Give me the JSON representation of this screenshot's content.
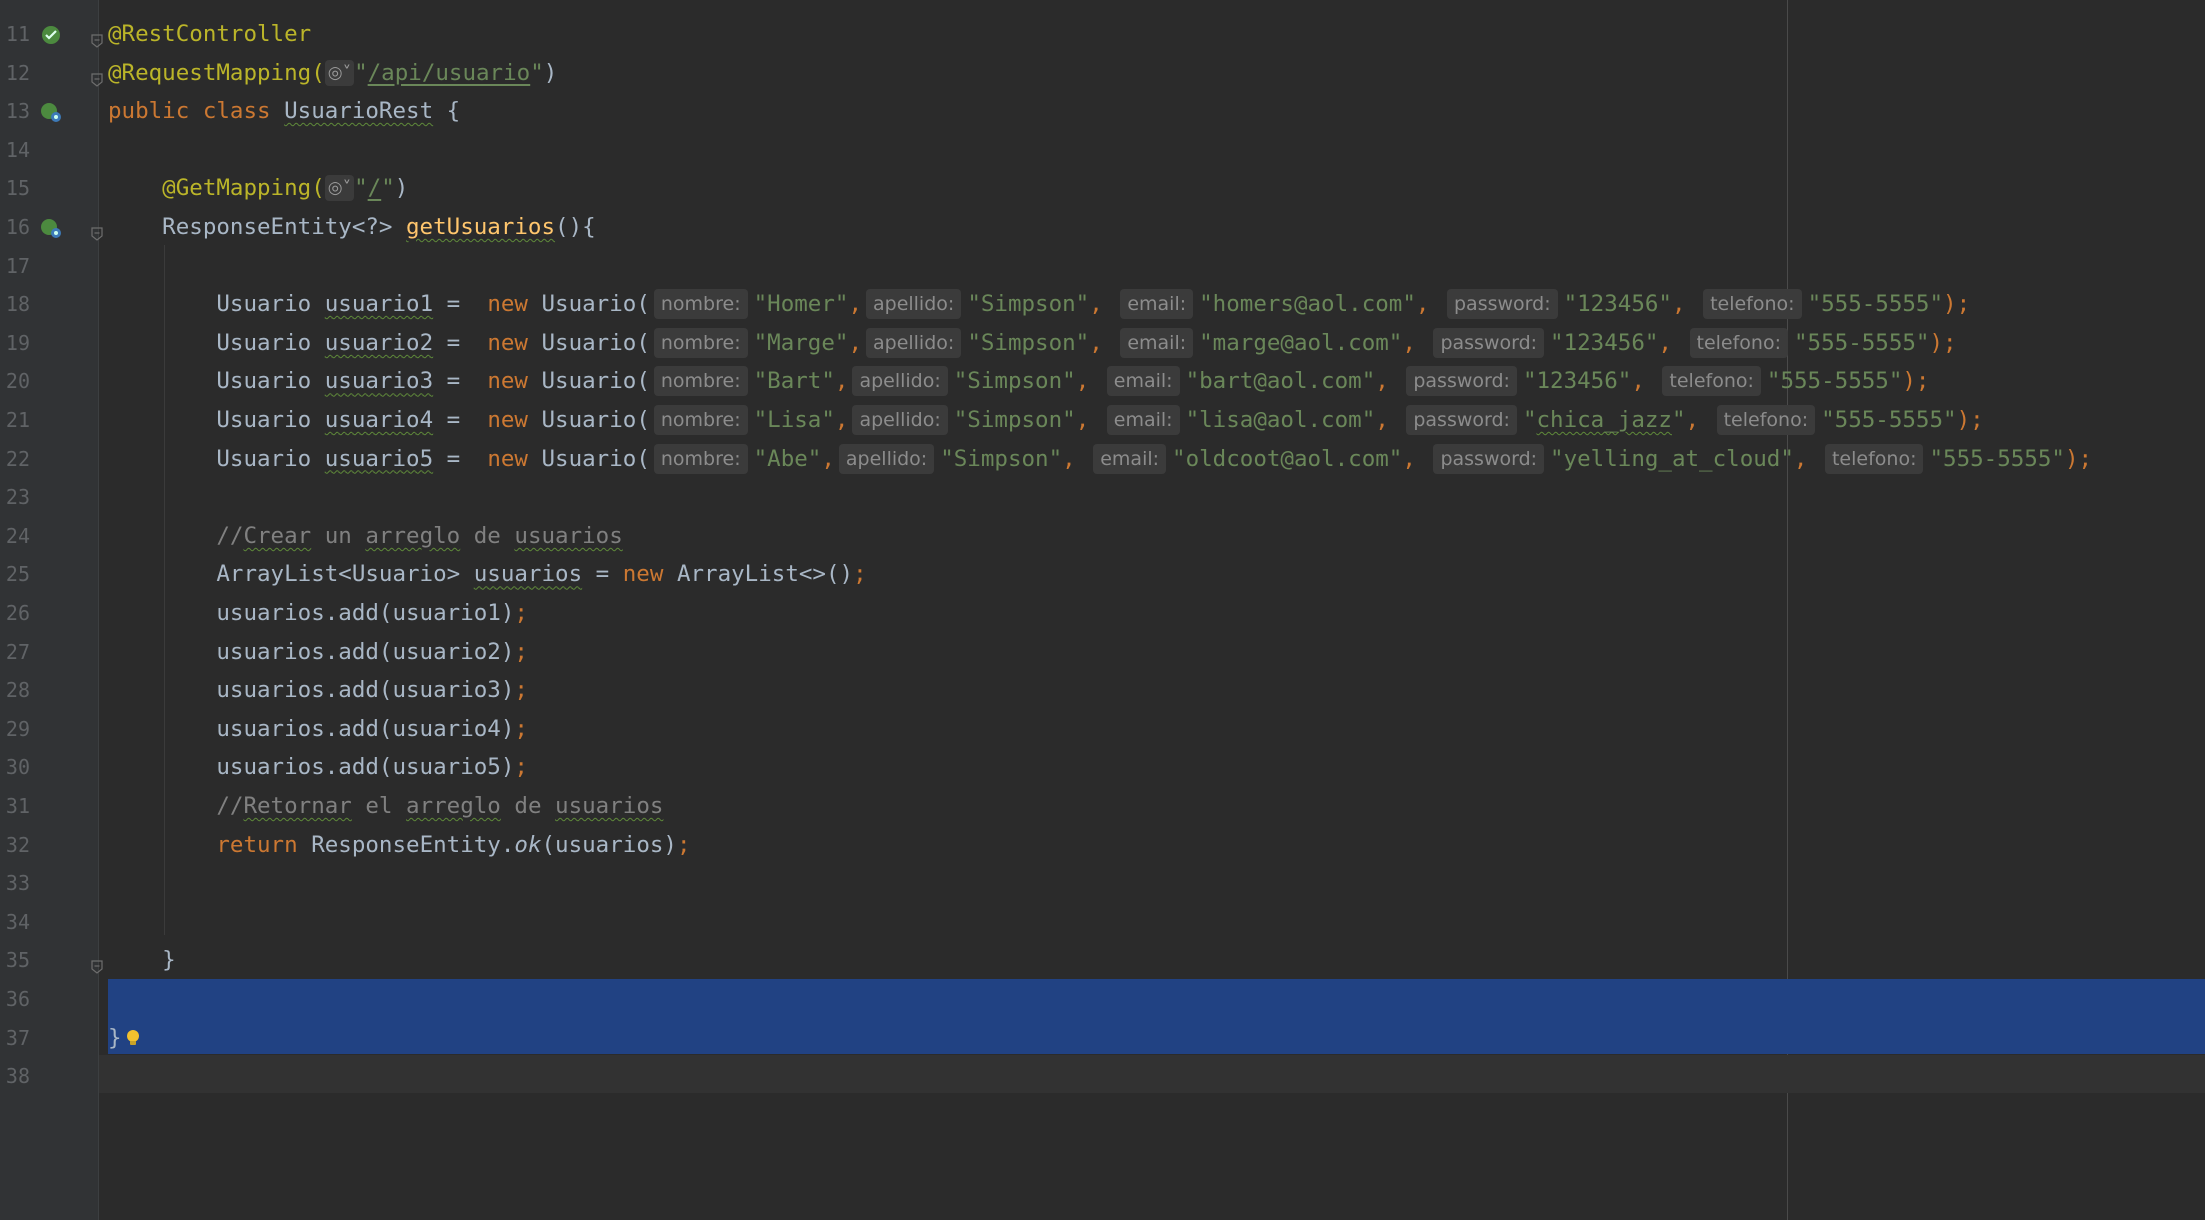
{
  "editor": {
    "language": "java",
    "first_line_number": 11,
    "lines": [
      {
        "n": "11",
        "segments": [
          {
            "t": "@RestController",
            "c": "ann"
          }
        ],
        "gutter_icon": "spring-bean-icon",
        "fold": true
      },
      {
        "n": "12",
        "segments": [
          {
            "t": "@RequestMapping(",
            "c": "ann"
          },
          {
            "t": "globe",
            "c": "globe"
          },
          {
            "t": "\"",
            "c": "str"
          },
          {
            "t": "/api/usuario",
            "c": "str link"
          },
          {
            "t": "\"",
            "c": "str"
          },
          {
            "t": ")",
            "c": ""
          }
        ],
        "fold": true
      },
      {
        "n": "13",
        "segments": [
          {
            "t": "public ",
            "c": "kw"
          },
          {
            "t": "class ",
            "c": "kw"
          },
          {
            "t": "UsuarioRest",
            "c": "typo"
          },
          {
            "t": " {",
            "c": ""
          }
        ],
        "gutter_icon": "spring-web-icon"
      },
      {
        "n": "14",
        "segments": []
      },
      {
        "n": "15",
        "segments": [
          {
            "t": "    @GetMapping(",
            "c": "ann"
          },
          {
            "t": "globe",
            "c": "globe"
          },
          {
            "t": "\"",
            "c": "str"
          },
          {
            "t": "/",
            "c": "str link"
          },
          {
            "t": "\"",
            "c": "str"
          },
          {
            "t": ")",
            "c": ""
          }
        ]
      },
      {
        "n": "16",
        "segments": [
          {
            "t": "    ResponseEntity<?> ",
            "c": ""
          },
          {
            "t": "getUsuarios",
            "c": "fn typo"
          },
          {
            "t": "(){",
            "c": ""
          }
        ],
        "gutter_icon": "spring-web-icon",
        "fold": true
      },
      {
        "n": "17",
        "segments": []
      },
      {
        "n": "18",
        "segments": [
          {
            "t": "        Usuario ",
            "c": ""
          },
          {
            "t": "usuario1",
            "c": "typo"
          },
          {
            "t": " =  ",
            "c": ""
          },
          {
            "t": "new ",
            "c": "kw"
          },
          {
            "t": "Usuario(",
            "c": ""
          },
          {
            "t": "nombre:",
            "c": "hint"
          },
          {
            "t": "\"Homer\"",
            "c": "str"
          },
          {
            "t": ",",
            "c": "kw"
          },
          {
            "t": "apellido:",
            "c": "hint"
          },
          {
            "t": "\"Simpson\"",
            "c": "str"
          },
          {
            "t": ", ",
            "c": "kw"
          },
          {
            "t": "email:",
            "c": "hint"
          },
          {
            "t": "\"homers@aol.com\"",
            "c": "str"
          },
          {
            "t": ", ",
            "c": "kw"
          },
          {
            "t": "password:",
            "c": "hint"
          },
          {
            "t": "\"123456\"",
            "c": "str"
          },
          {
            "t": ", ",
            "c": "kw"
          },
          {
            "t": "telefono:",
            "c": "hint"
          },
          {
            "t": "\"555-5555\"",
            "c": "str"
          },
          {
            "t": ");",
            "c": "kw"
          }
        ]
      },
      {
        "n": "19",
        "segments": [
          {
            "t": "        Usuario ",
            "c": ""
          },
          {
            "t": "usuario2",
            "c": "typo"
          },
          {
            "t": " =  ",
            "c": ""
          },
          {
            "t": "new ",
            "c": "kw"
          },
          {
            "t": "Usuario(",
            "c": ""
          },
          {
            "t": "nombre:",
            "c": "hint"
          },
          {
            "t": "\"Marge\"",
            "c": "str"
          },
          {
            "t": ",",
            "c": "kw"
          },
          {
            "t": "apellido:",
            "c": "hint"
          },
          {
            "t": "\"Simpson\"",
            "c": "str"
          },
          {
            "t": ", ",
            "c": "kw"
          },
          {
            "t": "email:",
            "c": "hint"
          },
          {
            "t": "\"marge@aol.com\"",
            "c": "str"
          },
          {
            "t": ", ",
            "c": "kw"
          },
          {
            "t": "password:",
            "c": "hint"
          },
          {
            "t": "\"123456\"",
            "c": "str"
          },
          {
            "t": ", ",
            "c": "kw"
          },
          {
            "t": "telefono:",
            "c": "hint"
          },
          {
            "t": "\"555-5555\"",
            "c": "str"
          },
          {
            "t": ");",
            "c": "kw"
          }
        ]
      },
      {
        "n": "20",
        "segments": [
          {
            "t": "        Usuario ",
            "c": ""
          },
          {
            "t": "usuario3",
            "c": "typo"
          },
          {
            "t": " =  ",
            "c": ""
          },
          {
            "t": "new ",
            "c": "kw"
          },
          {
            "t": "Usuario(",
            "c": ""
          },
          {
            "t": "nombre:",
            "c": "hint"
          },
          {
            "t": "\"Bart\"",
            "c": "str"
          },
          {
            "t": ",",
            "c": "kw"
          },
          {
            "t": "apellido:",
            "c": "hint"
          },
          {
            "t": "\"Simpson\"",
            "c": "str"
          },
          {
            "t": ", ",
            "c": "kw"
          },
          {
            "t": "email:",
            "c": "hint"
          },
          {
            "t": "\"bart@aol.com\"",
            "c": "str"
          },
          {
            "t": ", ",
            "c": "kw"
          },
          {
            "t": "password:",
            "c": "hint"
          },
          {
            "t": "\"123456\"",
            "c": "str"
          },
          {
            "t": ", ",
            "c": "kw"
          },
          {
            "t": "telefono:",
            "c": "hint"
          },
          {
            "t": "\"555-5555\"",
            "c": "str"
          },
          {
            "t": ");",
            "c": "kw"
          }
        ]
      },
      {
        "n": "21",
        "segments": [
          {
            "t": "        Usuario ",
            "c": ""
          },
          {
            "t": "usuario4",
            "c": "typo"
          },
          {
            "t": " =  ",
            "c": ""
          },
          {
            "t": "new ",
            "c": "kw"
          },
          {
            "t": "Usuario(",
            "c": ""
          },
          {
            "t": "nombre:",
            "c": "hint"
          },
          {
            "t": "\"Lisa\"",
            "c": "str"
          },
          {
            "t": ",",
            "c": "kw"
          },
          {
            "t": "apellido:",
            "c": "hint"
          },
          {
            "t": "\"Simpson\"",
            "c": "str"
          },
          {
            "t": ", ",
            "c": "kw"
          },
          {
            "t": "email:",
            "c": "hint"
          },
          {
            "t": "\"lisa@aol.com\"",
            "c": "str"
          },
          {
            "t": ", ",
            "c": "kw"
          },
          {
            "t": "password:",
            "c": "hint"
          },
          {
            "t": "\"",
            "c": "str"
          },
          {
            "t": "chica_jazz",
            "c": "str typo"
          },
          {
            "t": "\"",
            "c": "str"
          },
          {
            "t": ", ",
            "c": "kw"
          },
          {
            "t": "telefono:",
            "c": "hint"
          },
          {
            "t": "\"555-5555\"",
            "c": "str"
          },
          {
            "t": ");",
            "c": "kw"
          }
        ]
      },
      {
        "n": "22",
        "segments": [
          {
            "t": "        Usuario ",
            "c": ""
          },
          {
            "t": "usuario5",
            "c": "typo"
          },
          {
            "t": " =  ",
            "c": ""
          },
          {
            "t": "new ",
            "c": "kw"
          },
          {
            "t": "Usuario(",
            "c": ""
          },
          {
            "t": "nombre:",
            "c": "hint"
          },
          {
            "t": "\"Abe\"",
            "c": "str"
          },
          {
            "t": ",",
            "c": "kw"
          },
          {
            "t": "apellido:",
            "c": "hint"
          },
          {
            "t": "\"Simpson\"",
            "c": "str"
          },
          {
            "t": ", ",
            "c": "kw"
          },
          {
            "t": "email:",
            "c": "hint"
          },
          {
            "t": "\"oldcoot@aol.com\"",
            "c": "str"
          },
          {
            "t": ", ",
            "c": "kw"
          },
          {
            "t": "password:",
            "c": "hint"
          },
          {
            "t": "\"yelling_at_cloud\"",
            "c": "str"
          },
          {
            "t": ", ",
            "c": "kw"
          },
          {
            "t": "telefono:",
            "c": "hint"
          },
          {
            "t": "\"555-5555\"",
            "c": "str"
          },
          {
            "t": ");",
            "c": "kw"
          }
        ]
      },
      {
        "n": "23",
        "segments": []
      },
      {
        "n": "24",
        "segments": [
          {
            "t": "        //",
            "c": "cmt"
          },
          {
            "t": "Crear",
            "c": "cmt typo"
          },
          {
            "t": " un ",
            "c": "cmt"
          },
          {
            "t": "arreglo",
            "c": "cmt typo"
          },
          {
            "t": " de ",
            "c": "cmt"
          },
          {
            "t": "usuarios",
            "c": "cmt typo"
          }
        ]
      },
      {
        "n": "25",
        "segments": [
          {
            "t": "        ArrayList<Usuario> ",
            "c": ""
          },
          {
            "t": "usuarios",
            "c": "typo"
          },
          {
            "t": " = ",
            "c": ""
          },
          {
            "t": "new ",
            "c": "kw"
          },
          {
            "t": "ArrayList<>()",
            "c": ""
          },
          {
            "t": ";",
            "c": "kw"
          }
        ]
      },
      {
        "n": "26",
        "segments": [
          {
            "t": "        usuarios.add(usuario1)",
            "c": ""
          },
          {
            "t": ";",
            "c": "kw"
          }
        ]
      },
      {
        "n": "27",
        "segments": [
          {
            "t": "        usuarios.add(usuario2)",
            "c": ""
          },
          {
            "t": ";",
            "c": "kw"
          }
        ]
      },
      {
        "n": "28",
        "segments": [
          {
            "t": "        usuarios.add(usuario3)",
            "c": ""
          },
          {
            "t": ";",
            "c": "kw"
          }
        ]
      },
      {
        "n": "29",
        "segments": [
          {
            "t": "        usuarios.add(usuario4)",
            "c": ""
          },
          {
            "t": ";",
            "c": "kw"
          }
        ]
      },
      {
        "n": "30",
        "segments": [
          {
            "t": "        usuarios.add(usuario5)",
            "c": ""
          },
          {
            "t": ";",
            "c": "kw"
          }
        ]
      },
      {
        "n": "31",
        "segments": [
          {
            "t": "        //",
            "c": "cmt"
          },
          {
            "t": "Retornar",
            "c": "cmt typo"
          },
          {
            "t": " el ",
            "c": "cmt"
          },
          {
            "t": "arreglo",
            "c": "cmt typo"
          },
          {
            "t": " de ",
            "c": "cmt"
          },
          {
            "t": "usuarios",
            "c": "cmt typo"
          }
        ]
      },
      {
        "n": "32",
        "segments": [
          {
            "t": "        ",
            "c": ""
          },
          {
            "t": "return ",
            "c": "kw"
          },
          {
            "t": "ResponseEntity.",
            "c": ""
          },
          {
            "t": "ok",
            "c": "it"
          },
          {
            "t": "(usuarios)",
            "c": ""
          },
          {
            "t": ";",
            "c": "kw"
          }
        ]
      },
      {
        "n": "33",
        "segments": []
      },
      {
        "n": "34",
        "segments": []
      },
      {
        "n": "35",
        "segments": [
          {
            "t": "    }",
            "c": ""
          }
        ],
        "fold": true
      },
      {
        "n": "36",
        "segments": []
      },
      {
        "n": "37",
        "segments": [
          {
            "t": "}",
            "c": ""
          },
          {
            "t": "bulb",
            "c": "bulb"
          }
        ]
      },
      {
        "n": "38",
        "segments": []
      }
    ]
  },
  "colors": {
    "background": "#2b2b2b",
    "gutter": "#313335",
    "selection": "#214283",
    "keyword": "#cc7832",
    "string": "#6a8759",
    "annotation": "#bbb529",
    "comment": "#808080",
    "function": "#ffc66d"
  }
}
